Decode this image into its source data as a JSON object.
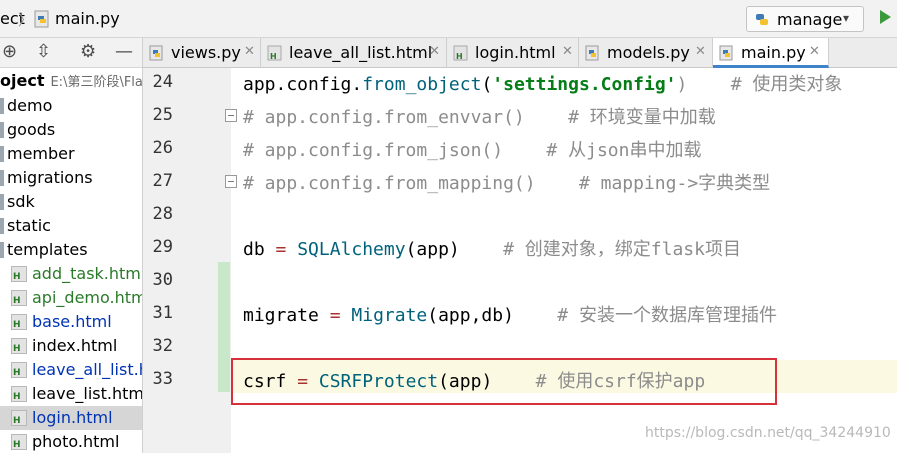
{
  "topbar": {
    "project_crumb": "ect",
    "file_crumb": "main.py",
    "run_config": "manage"
  },
  "project": {
    "root_name": "oject",
    "root_path": "E:\\第三阶段\\Fla",
    "folders": [
      "demo",
      "goods",
      "member",
      "migrations",
      "sdk",
      "static",
      "templates"
    ],
    "files": [
      {
        "name": "add_task.html",
        "status": "green"
      },
      {
        "name": "api_demo.html",
        "status": "green"
      },
      {
        "name": "base.html",
        "status": "blue"
      },
      {
        "name": "index.html",
        "status": "normal"
      },
      {
        "name": "leave_all_list.html",
        "status": "blue"
      },
      {
        "name": "leave_list.html",
        "status": "normal"
      },
      {
        "name": "login.html",
        "status": "blue",
        "selected": true
      },
      {
        "name": "photo.html",
        "status": "normal"
      }
    ]
  },
  "tabs": [
    {
      "label": "views.py",
      "icon": "python-file-icon",
      "color": "normal"
    },
    {
      "label": "leave_all_list.html",
      "icon": "html-file-icon",
      "color": "normal"
    },
    {
      "label": "login.html",
      "icon": "html-file-icon",
      "color": "normal"
    },
    {
      "label": "models.py",
      "icon": "python-file-icon",
      "color": "normal"
    },
    {
      "label": "main.py",
      "icon": "python-file-icon",
      "color": "normal",
      "active": true
    }
  ],
  "editor": {
    "line_numbers": [
      "24",
      "25",
      "26",
      "27",
      "28",
      "29",
      "30",
      "31",
      "32",
      "33"
    ],
    "lines": [
      [
        {
          "t": "app.config.",
          "c": ""
        },
        {
          "t": "from_object",
          "c": "fn"
        },
        {
          "t": "(",
          "c": ""
        },
        {
          "t": "'settings.Config'",
          "c": "str"
        },
        {
          "t": ")    # 使用类对象",
          "c": "cm"
        }
      ],
      [
        {
          "t": "# app.config.from_envvar()    # 环境变量中加载",
          "c": "cm"
        }
      ],
      [
        {
          "t": "# app.config.from_json()    # 从json串中加载",
          "c": "cm"
        }
      ],
      [
        {
          "t": "# app.config.from_mapping()    # mapping->字典类型",
          "c": "cm"
        }
      ],
      [],
      [
        {
          "t": "db ",
          "c": ""
        },
        {
          "t": "=",
          "c": "op"
        },
        {
          "t": " ",
          "c": ""
        },
        {
          "t": "SQLAlchemy",
          "c": "fn"
        },
        {
          "t": "(app)    ",
          "c": ""
        },
        {
          "t": "# 创建对象，绑定flask项目",
          "c": "cm"
        }
      ],
      [],
      [
        {
          "t": "migrate ",
          "c": ""
        },
        {
          "t": "=",
          "c": "op"
        },
        {
          "t": " ",
          "c": ""
        },
        {
          "t": "Migrate",
          "c": "fn"
        },
        {
          "t": "(app,db)    ",
          "c": ""
        },
        {
          "t": "# 安装一个数据库管理插件",
          "c": "cm"
        }
      ],
      [],
      [
        {
          "t": "csrf ",
          "c": ""
        },
        {
          "t": "=",
          "c": "op"
        },
        {
          "t": " ",
          "c": ""
        },
        {
          "t": "CSRFProtect",
          "c": "fn"
        },
        {
          "t": "(app)    ",
          "c": ""
        },
        {
          "t": "# 使用csrf保护app",
          "c": "cm"
        }
      ]
    ]
  },
  "watermark": "https://blog.csdn.net/qq_34244910",
  "colors": {
    "accent": "#4083c9",
    "highlight_box": "#d6303a",
    "run": "#3c9a3c"
  }
}
